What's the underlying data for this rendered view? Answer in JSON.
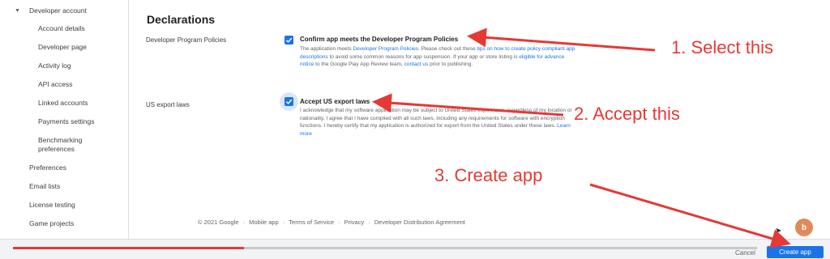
{
  "sidebar": {
    "group_title": "Developer account",
    "sub_items": [
      {
        "label": "Account details"
      },
      {
        "label": "Developer page"
      },
      {
        "label": "Activity log"
      },
      {
        "label": "API access"
      },
      {
        "label": "Linked accounts"
      },
      {
        "label": "Payments settings"
      },
      {
        "label": "Benchmarking preferences"
      }
    ],
    "top_items": [
      {
        "label": "Preferences"
      },
      {
        "label": "Email lists"
      },
      {
        "label": "License testing"
      },
      {
        "label": "Game projects"
      }
    ]
  },
  "main": {
    "section_title": "Declarations",
    "policies": {
      "row_label": "Developer Program Policies",
      "checkbox_title": "Confirm app meets the Developer Program Policies",
      "checked": true,
      "desc_1": "The application meets ",
      "link_1": "Developer Program Policies",
      "desc_2": ". Please check out these ",
      "link_2": "tips on how to create policy compliant app descriptions",
      "desc_3": " to avoid some common reasons for app suspension. If your app or store listing is ",
      "link_3": "eligible for advance notice",
      "desc_4": " to the Google Play App Review team, ",
      "link_4": "contact us",
      "desc_5": " prior to publishing."
    },
    "export": {
      "row_label": "US export laws",
      "checkbox_title": "Accept US export laws",
      "checked": true,
      "desc": "I acknowledge that my software application may be subject to United States export laws, regardless of my location or nationality. I agree that I have complied with all such laws, including any requirements for software with encryption functions. I hereby certify that my application is authorized for export from the United States under these laws. ",
      "link": "Learn more"
    }
  },
  "footer": {
    "copyright": "© 2021 Google",
    "links": [
      "Mobile app",
      "Terms of Service",
      "Privacy",
      "Developer Distribution Agreement"
    ]
  },
  "actions": {
    "cancel_label": "Cancel",
    "create_label": "Create app"
  },
  "video_progress": 0.31,
  "annotations": {
    "step1": "1. Select this",
    "step2": "2. Accept this",
    "step3": "3. Create app"
  },
  "colors": {
    "accent": "#1a73e8",
    "annotation": "#e53935"
  }
}
